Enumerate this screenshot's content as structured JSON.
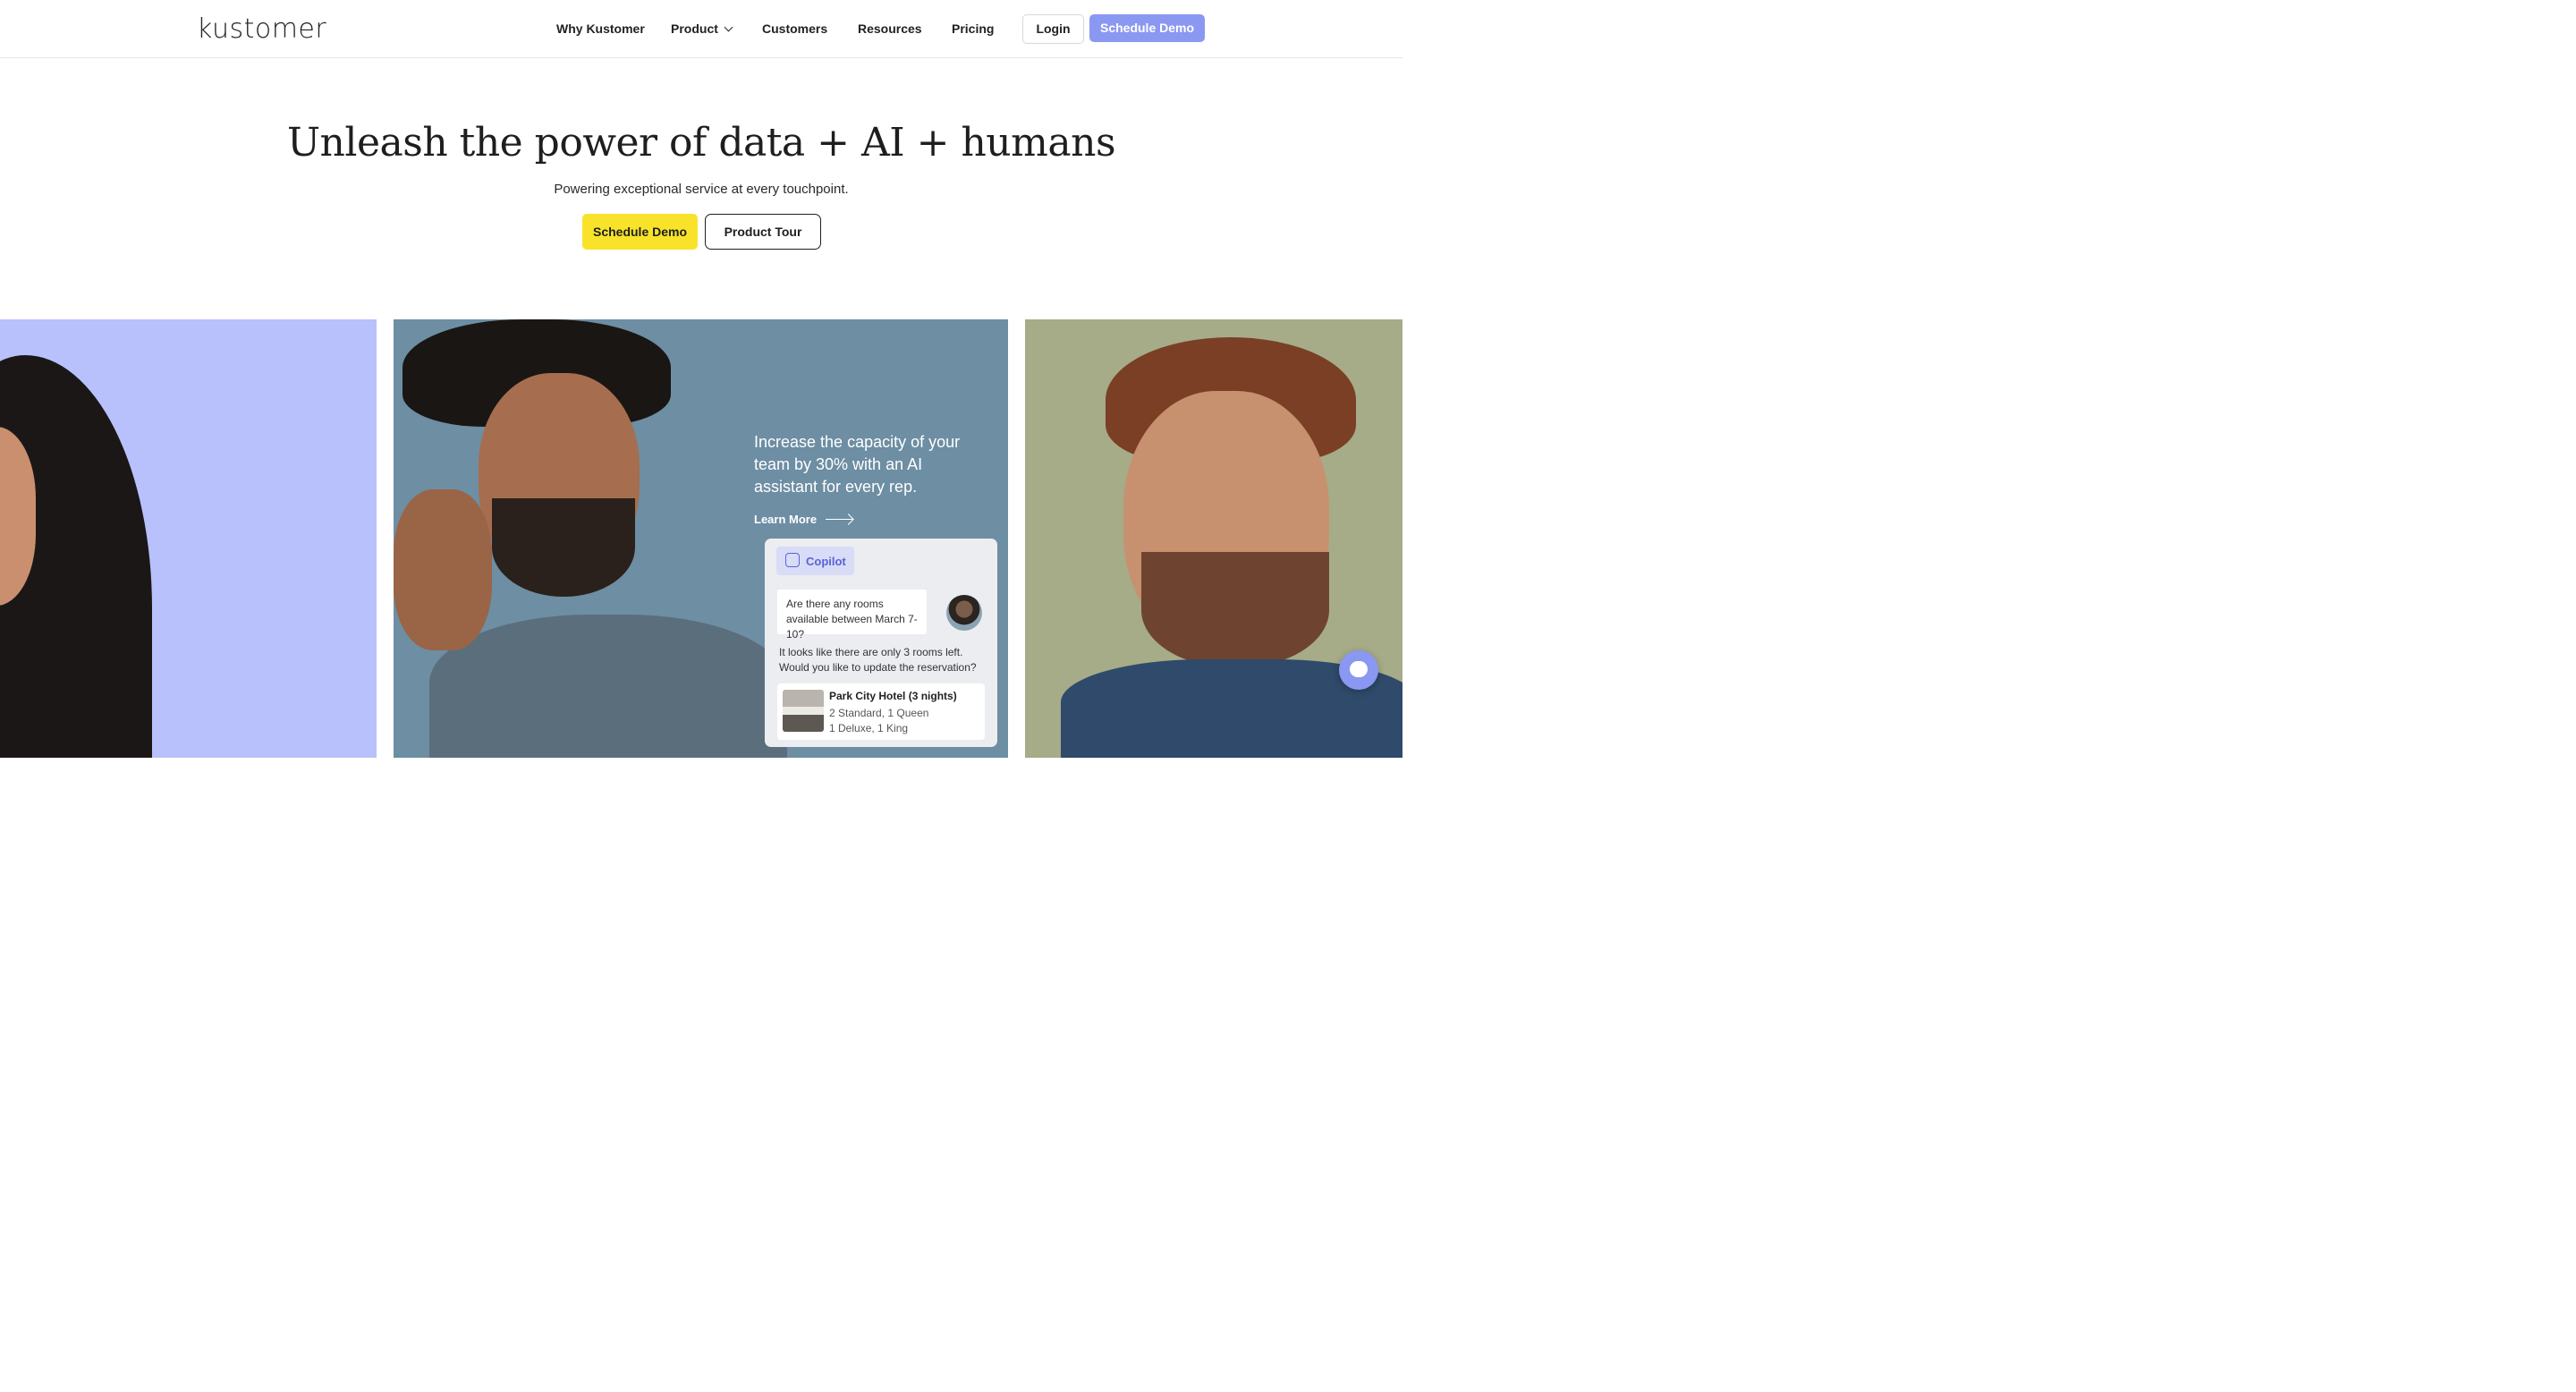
{
  "nav": {
    "logo": "kustomer",
    "links": [
      "Why Kustomer",
      "Product",
      "Customers",
      "Resources",
      "Pricing"
    ],
    "login": "Login",
    "demo": "Schedule Demo"
  },
  "hero": {
    "title": "Unleash the power of data + AI + humans",
    "subtitle": "Powering exceptional service at every touchpoint.",
    "primary_cta": "Schedule Demo",
    "secondary_cta": "Product Tour"
  },
  "feature": {
    "promo": "Increase the capacity of your team by 30% with an AI assistant for every rep.",
    "learn_more": "Learn More",
    "copilot_label": "Copilot",
    "question": "Are there any rooms available between March 7-10?",
    "answer": "It looks like there are only 3 rooms left. Would you like to update the reservation?",
    "hotel_name": "Park City Hotel (3 nights)",
    "hotel_line1": "2 Standard, 1 Queen",
    "hotel_line2": "1 Deluxe, 1 King"
  },
  "colors": {
    "accent": "#8b98f2",
    "cta_yellow": "#f8e32a",
    "panel_left": "#b8c1fb",
    "panel_mid": "#6d8ea3",
    "panel_right": "#a6ab88"
  }
}
